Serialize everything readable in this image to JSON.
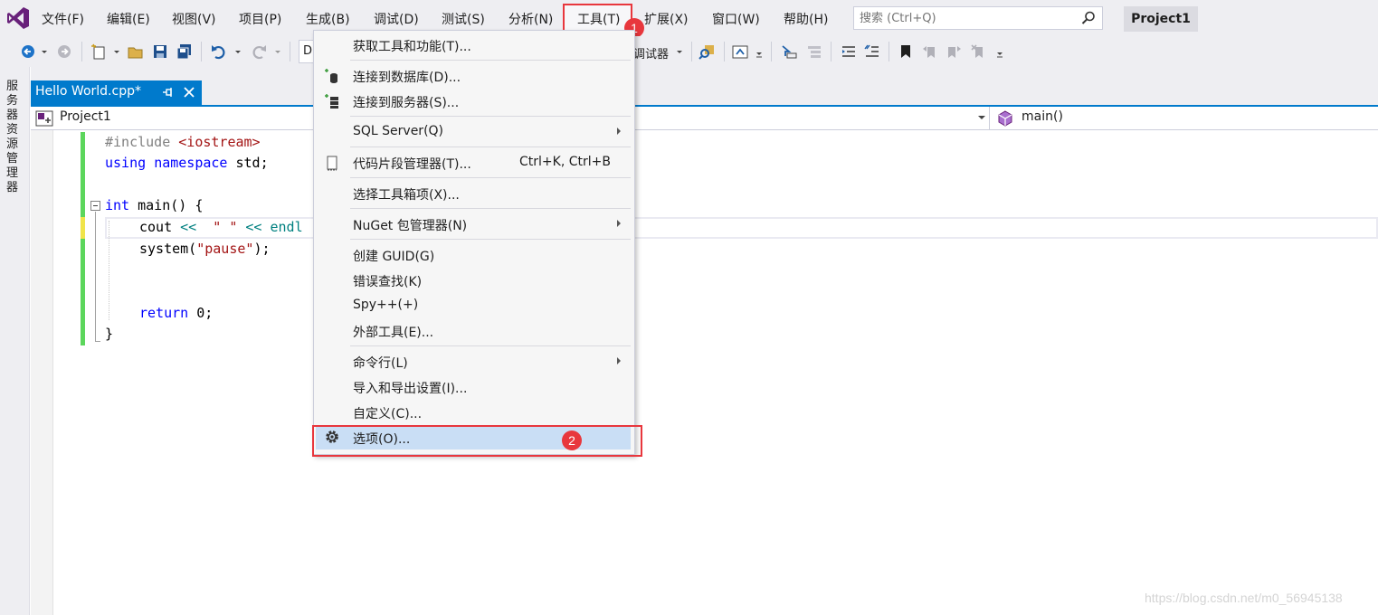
{
  "menubar": {
    "items": [
      "文件(F)",
      "编辑(E)",
      "视图(V)",
      "项目(P)",
      "生成(B)",
      "调试(D)",
      "测试(S)",
      "分析(N)",
      "工具(T)",
      "扩展(X)",
      "窗口(W)",
      "帮助(H)"
    ],
    "search_placeholder": "搜索 (Ctrl+Q)",
    "project_name": "Project1"
  },
  "toolbar": {
    "config_value": "D",
    "debugger_label": "调试器"
  },
  "left_strip": {
    "label": "服务器资源管理器"
  },
  "tab": {
    "title": "Hello World.cpp*",
    "pin_glyph": "⊣",
    "close_glyph": "✕"
  },
  "navbar": {
    "project": "Project1",
    "function": "main()"
  },
  "code": {
    "line1_a": "#include ",
    "line1_b": "<iostream>",
    "line2_kw1": "using",
    "line2_kw2": "namespace",
    "line2_rest": " std;",
    "line4_kw": "int",
    "line4_rest": " main() {",
    "line5_a": "cout ",
    "line5_op1": "<<",
    "line5_str": "  \" \"",
    "line5_op2": " <<",
    "line5_rest": " endl",
    "line6_a": "system(",
    "line6_str": "\"pause\"",
    "line6_b": ");",
    "line9_kw": "return",
    "line9_rest": " 0;",
    "line10": "}"
  },
  "tools_menu": {
    "items": [
      {
        "label": "获取工具和功能(T)...",
        "shortcut": "",
        "submenu": false,
        "icon": ""
      },
      {
        "label": "连接到数据库(D)...",
        "shortcut": "",
        "submenu": false,
        "icon": "database-icon"
      },
      {
        "label": "连接到服务器(S)...",
        "shortcut": "",
        "submenu": false,
        "icon": "server-icon"
      },
      {
        "label": "SQL Server(Q)",
        "shortcut": "",
        "submenu": true,
        "icon": ""
      },
      {
        "label": "代码片段管理器(T)...",
        "shortcut": "Ctrl+K, Ctrl+B",
        "submenu": false,
        "icon": "snippet-icon"
      },
      {
        "label": "选择工具箱项(X)...",
        "shortcut": "",
        "submenu": false,
        "icon": ""
      },
      {
        "label": "NuGet 包管理器(N)",
        "shortcut": "",
        "submenu": true,
        "icon": ""
      },
      {
        "label": "创建 GUID(G)",
        "shortcut": "",
        "submenu": false,
        "icon": ""
      },
      {
        "label": "错误查找(K)",
        "shortcut": "",
        "submenu": false,
        "icon": ""
      },
      {
        "label": "Spy++(+)",
        "shortcut": "",
        "submenu": false,
        "icon": ""
      },
      {
        "label": "外部工具(E)...",
        "shortcut": "",
        "submenu": false,
        "icon": ""
      },
      {
        "label": "命令行(L)",
        "shortcut": "",
        "submenu": true,
        "icon": ""
      },
      {
        "label": "导入和导出设置(I)...",
        "shortcut": "",
        "submenu": false,
        "icon": ""
      },
      {
        "label": "自定义(C)...",
        "shortcut": "",
        "submenu": false,
        "icon": ""
      },
      {
        "label": "选项(O)...",
        "shortcut": "",
        "submenu": false,
        "icon": "gear-icon"
      }
    ]
  },
  "annotations": {
    "badge1": "1",
    "badge2": "2"
  },
  "watermark": "https://blog.csdn.net/m0_56945138",
  "colors": {
    "accent": "#007acc",
    "highlight_box": "#e8373d",
    "menu_hover": "#c9def5",
    "change_bar": "#5cd65c"
  }
}
